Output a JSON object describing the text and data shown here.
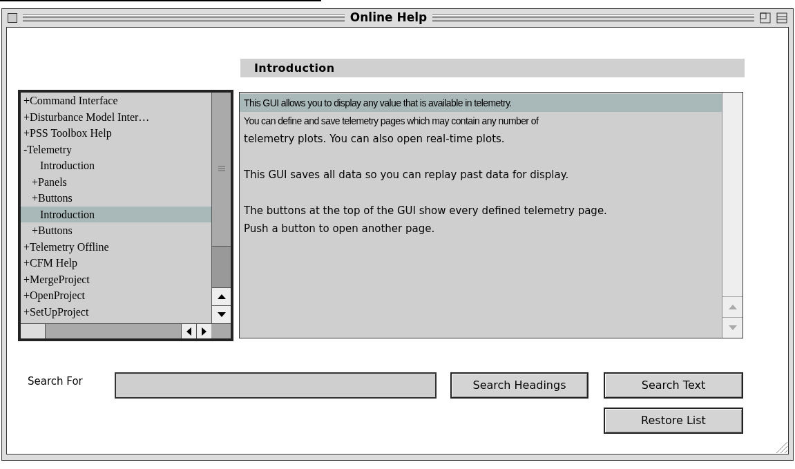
{
  "window": {
    "title": "Online Help"
  },
  "heading": "Introduction",
  "tree": [
    {
      "label": "+Command Interface",
      "selected": false
    },
    {
      "label": "+Disturbance Model Inter…",
      "selected": false
    },
    {
      "label": "+PSS Toolbox Help",
      "selected": false
    },
    {
      "label": "-Telemetry",
      "selected": false,
      "children": [
        {
          "label": "Introduction",
          "selected": false,
          "leaf": true
        },
        {
          "label": "+Panels",
          "selected": false
        },
        {
          "label": "+Buttons",
          "selected": false
        },
        {
          "label": "Introduction",
          "selected": true,
          "leaf": true
        },
        {
          "label": "+Buttons",
          "selected": false
        }
      ]
    },
    {
      "label": "+Telemetry Offline",
      "selected": false
    },
    {
      "label": "+CFM Help",
      "selected": false
    },
    {
      "label": "+MergeProject",
      "selected": false
    },
    {
      "label": "+OpenProject",
      "selected": false
    },
    {
      "label": "+SetUpProject",
      "selected": false
    }
  ],
  "content": [
    {
      "text": "This GUI allows you to display any value that is available in telemetry.",
      "selected": true,
      "kind": "condensed"
    },
    {
      "text": "You can define and save telemetry pages which may contain any number of",
      "selected": false,
      "kind": "condensed"
    },
    {
      "text": "telemetry plots. You can also open real-time plots.",
      "selected": false,
      "kind": "normal"
    },
    {
      "kind": "blank"
    },
    {
      "text": "This GUI saves all data so you can replay past data for display.",
      "selected": false,
      "kind": "normal"
    },
    {
      "kind": "blank"
    },
    {
      "text": "The buttons at the top of the GUI show every defined telemetry page.",
      "selected": false,
      "kind": "normal"
    },
    {
      "text": "Push a button to open another page.",
      "selected": false,
      "kind": "normal"
    }
  ],
  "search": {
    "label": "Search For"
  },
  "buttons": [
    "Search Headings",
    "Search Text",
    "Restore List"
  ]
}
